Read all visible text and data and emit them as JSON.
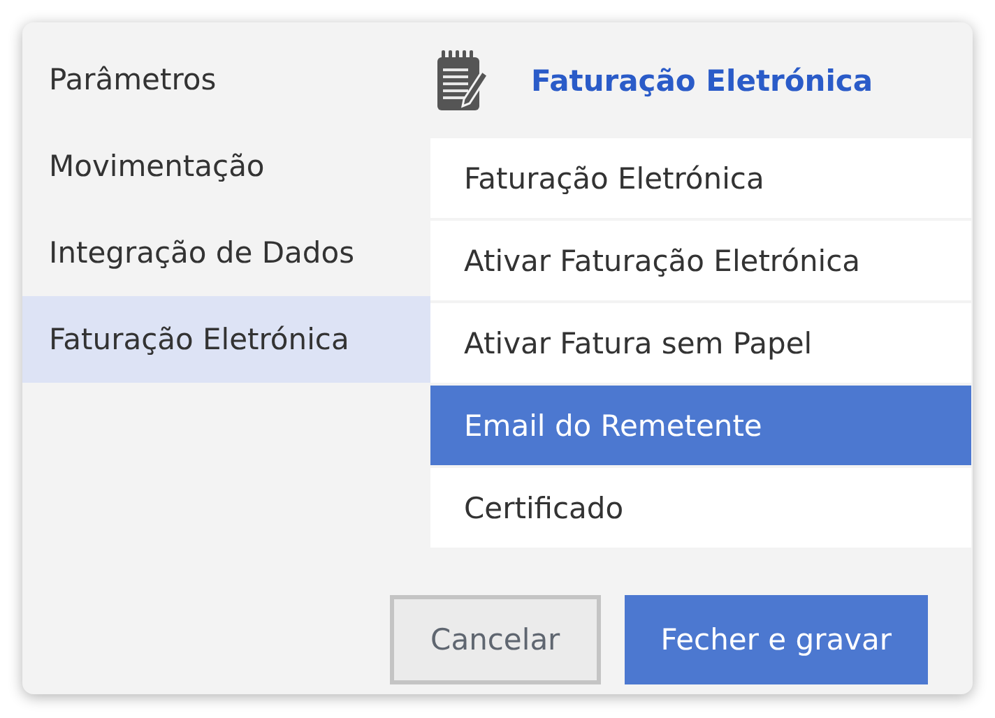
{
  "sidebar": {
    "items": [
      {
        "label": "Parâmetros",
        "selected": false
      },
      {
        "label": "Movimentação",
        "selected": false
      },
      {
        "label": "Integração de Dados",
        "selected": false
      },
      {
        "label": "Faturação Eletrónica",
        "selected": true
      }
    ]
  },
  "panel": {
    "title": "Faturação Eletrónica",
    "items": [
      {
        "label": "Faturação Eletrónica",
        "selected": false
      },
      {
        "label": "Ativar Faturação Eletrónica",
        "selected": false
      },
      {
        "label": "Ativar Fatura sem Papel",
        "selected": false
      },
      {
        "label": "Email do Remetente",
        "selected": true
      },
      {
        "label": "Certificado",
        "selected": false
      }
    ]
  },
  "buttons": [
    {
      "label": "Cancelar",
      "kind": "secondary"
    },
    {
      "label": "Fecher e gravar",
      "kind": "primary"
    }
  ]
}
